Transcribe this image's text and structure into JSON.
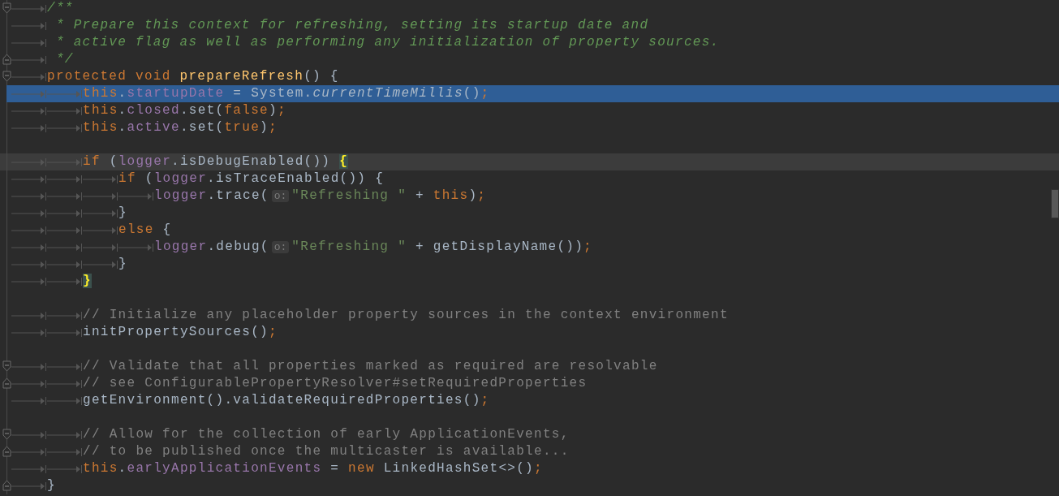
{
  "editor": {
    "lines": [
      {
        "selected": false,
        "caret": false,
        "fold_start": true,
        "fold_end": false,
        "indent": [
          {
            "kind": "tab"
          }
        ],
        "tokens": [
          {
            "kind": "doc",
            "text": "/**"
          }
        ]
      },
      {
        "selected": false,
        "caret": false,
        "fold_start": false,
        "fold_end": false,
        "indent": [
          {
            "kind": "tab"
          }
        ],
        "tokens": [
          {
            "kind": "doc",
            "text": " * Prepare this context for refreshing, setting its startup date and"
          }
        ]
      },
      {
        "selected": false,
        "caret": false,
        "fold_start": false,
        "fold_end": false,
        "indent": [
          {
            "kind": "tab"
          }
        ],
        "tokens": [
          {
            "kind": "doc",
            "text": " * active flag as well as performing any initialization of property sources."
          }
        ]
      },
      {
        "selected": false,
        "caret": false,
        "fold_start": false,
        "fold_end": true,
        "indent": [
          {
            "kind": "tab"
          }
        ],
        "tokens": [
          {
            "kind": "doc",
            "text": " */"
          }
        ]
      },
      {
        "selected": false,
        "caret": false,
        "fold_start": true,
        "fold_end": false,
        "indent": [
          {
            "kind": "tab"
          }
        ],
        "tokens": [
          {
            "kind": "keyword",
            "text": "protected void "
          },
          {
            "kind": "declaration",
            "text": "prepareRefresh"
          },
          {
            "kind": "plain",
            "text": "() {"
          }
        ]
      },
      {
        "selected": true,
        "caret": false,
        "fold_start": false,
        "fold_end": false,
        "indent": [
          {
            "kind": "tab"
          },
          {
            "kind": "tab"
          }
        ],
        "tokens": [
          {
            "kind": "keyword",
            "text": "this"
          },
          {
            "kind": "plain",
            "text": "."
          },
          {
            "kind": "field",
            "text": "startupDate"
          },
          {
            "kind": "plain",
            "text": " = System."
          },
          {
            "kind": "static",
            "text": "currentTimeMillis"
          },
          {
            "kind": "plain",
            "text": "()"
          },
          {
            "kind": "keyword",
            "text": ";"
          }
        ]
      },
      {
        "selected": false,
        "caret": false,
        "fold_start": false,
        "fold_end": false,
        "indent": [
          {
            "kind": "tab"
          },
          {
            "kind": "tab"
          }
        ],
        "tokens": [
          {
            "kind": "keyword",
            "text": "this"
          },
          {
            "kind": "plain",
            "text": "."
          },
          {
            "kind": "field",
            "text": "closed"
          },
          {
            "kind": "plain",
            "text": ".set("
          },
          {
            "kind": "keyword",
            "text": "false"
          },
          {
            "kind": "plain",
            "text": ")"
          },
          {
            "kind": "keyword",
            "text": ";"
          }
        ]
      },
      {
        "selected": false,
        "caret": false,
        "fold_start": false,
        "fold_end": false,
        "indent": [
          {
            "kind": "tab"
          },
          {
            "kind": "tab"
          }
        ],
        "tokens": [
          {
            "kind": "keyword",
            "text": "this"
          },
          {
            "kind": "plain",
            "text": "."
          },
          {
            "kind": "field",
            "text": "active"
          },
          {
            "kind": "plain",
            "text": ".set("
          },
          {
            "kind": "keyword",
            "text": "true"
          },
          {
            "kind": "plain",
            "text": ")"
          },
          {
            "kind": "keyword",
            "text": ";"
          }
        ]
      },
      {
        "selected": false,
        "caret": false,
        "fold_start": false,
        "fold_end": false
      },
      {
        "selected": false,
        "caret": true,
        "fold_start": false,
        "fold_end": false,
        "indent": [
          {
            "kind": "tab"
          },
          {
            "kind": "tab"
          }
        ],
        "tokens": [
          {
            "kind": "keyword",
            "text": "if "
          },
          {
            "kind": "plain",
            "text": "("
          },
          {
            "kind": "field",
            "text": "logger"
          },
          {
            "kind": "plain",
            "text": ".isDebugEnabled()) "
          },
          {
            "kind": "brace-match",
            "text": "{"
          }
        ]
      },
      {
        "selected": false,
        "caret": false,
        "fold_start": false,
        "fold_end": false,
        "indent": [
          {
            "kind": "tab"
          },
          {
            "kind": "tab"
          },
          {
            "kind": "tab"
          }
        ],
        "tokens": [
          {
            "kind": "keyword",
            "text": "if "
          },
          {
            "kind": "plain",
            "text": "("
          },
          {
            "kind": "field",
            "text": "logger"
          },
          {
            "kind": "plain",
            "text": ".isTraceEnabled()) {"
          }
        ]
      },
      {
        "selected": false,
        "caret": false,
        "fold_start": false,
        "fold_end": false,
        "indent": [
          {
            "kind": "tab"
          },
          {
            "kind": "tab"
          },
          {
            "kind": "tab"
          },
          {
            "kind": "tab"
          }
        ],
        "tokens": [
          {
            "kind": "field",
            "text": "logger"
          },
          {
            "kind": "plain",
            "text": ".trace("
          },
          {
            "kind": "hint",
            "text": "o:"
          },
          {
            "kind": "string",
            "text": "\"Refreshing \""
          },
          {
            "kind": "plain",
            "text": " + "
          },
          {
            "kind": "keyword",
            "text": "this"
          },
          {
            "kind": "plain",
            "text": ")"
          },
          {
            "kind": "keyword",
            "text": ";"
          }
        ]
      },
      {
        "selected": false,
        "caret": false,
        "fold_start": false,
        "fold_end": false,
        "indent": [
          {
            "kind": "tab"
          },
          {
            "kind": "tab"
          },
          {
            "kind": "tab"
          }
        ],
        "tokens": [
          {
            "kind": "plain",
            "text": "}"
          }
        ]
      },
      {
        "selected": false,
        "caret": false,
        "fold_start": false,
        "fold_end": false,
        "indent": [
          {
            "kind": "tab"
          },
          {
            "kind": "tab"
          },
          {
            "kind": "tab"
          }
        ],
        "tokens": [
          {
            "kind": "keyword",
            "text": "else "
          },
          {
            "kind": "plain",
            "text": "{"
          }
        ]
      },
      {
        "selected": false,
        "caret": false,
        "fold_start": false,
        "fold_end": false,
        "indent": [
          {
            "kind": "tab"
          },
          {
            "kind": "tab"
          },
          {
            "kind": "tab"
          },
          {
            "kind": "tab"
          }
        ],
        "tokens": [
          {
            "kind": "field",
            "text": "logger"
          },
          {
            "kind": "plain",
            "text": ".debug("
          },
          {
            "kind": "hint",
            "text": "o:"
          },
          {
            "kind": "string",
            "text": "\"Refreshing \""
          },
          {
            "kind": "plain",
            "text": " + getDisplayName())"
          },
          {
            "kind": "keyword",
            "text": ";"
          }
        ]
      },
      {
        "selected": false,
        "caret": false,
        "fold_start": false,
        "fold_end": false,
        "indent": [
          {
            "kind": "tab"
          },
          {
            "kind": "tab"
          },
          {
            "kind": "tab"
          }
        ],
        "tokens": [
          {
            "kind": "plain",
            "text": "}"
          }
        ]
      },
      {
        "selected": false,
        "caret": false,
        "fold_start": false,
        "fold_end": false,
        "indent": [
          {
            "kind": "tab"
          },
          {
            "kind": "tab"
          }
        ],
        "tokens": [
          {
            "kind": "brace-match",
            "text": "}"
          }
        ]
      },
      {
        "selected": false,
        "caret": false,
        "fold_start": false,
        "fold_end": false
      },
      {
        "selected": false,
        "caret": false,
        "fold_start": false,
        "fold_end": false,
        "indent": [
          {
            "kind": "tab"
          },
          {
            "kind": "tab"
          }
        ],
        "tokens": [
          {
            "kind": "comment",
            "text": "// Initialize any placeholder property sources in the context environment"
          }
        ]
      },
      {
        "selected": false,
        "caret": false,
        "fold_start": false,
        "fold_end": false,
        "indent": [
          {
            "kind": "tab"
          },
          {
            "kind": "tab"
          }
        ],
        "tokens": [
          {
            "kind": "plain",
            "text": "initPropertySources()"
          },
          {
            "kind": "keyword",
            "text": ";"
          }
        ]
      },
      {
        "selected": false,
        "caret": false,
        "fold_start": false,
        "fold_end": false
      },
      {
        "selected": false,
        "caret": false,
        "fold_start": true,
        "fold_end": false,
        "indent": [
          {
            "kind": "tab"
          },
          {
            "kind": "tab"
          }
        ],
        "tokens": [
          {
            "kind": "comment",
            "text": "// Validate that all properties marked as required are resolvable"
          }
        ]
      },
      {
        "selected": false,
        "caret": false,
        "fold_start": false,
        "fold_end": true,
        "indent": [
          {
            "kind": "tab"
          },
          {
            "kind": "tab"
          }
        ],
        "tokens": [
          {
            "kind": "comment",
            "text": "// see ConfigurablePropertyResolver#setRequiredProperties"
          }
        ]
      },
      {
        "selected": false,
        "caret": false,
        "fold_start": false,
        "fold_end": false,
        "indent": [
          {
            "kind": "tab"
          },
          {
            "kind": "tab"
          }
        ],
        "tokens": [
          {
            "kind": "plain",
            "text": "getEnvironment().validateRequiredProperties()"
          },
          {
            "kind": "keyword",
            "text": ";"
          }
        ]
      },
      {
        "selected": false,
        "caret": false,
        "fold_start": false,
        "fold_end": false
      },
      {
        "selected": false,
        "caret": false,
        "fold_start": true,
        "fold_end": false,
        "indent": [
          {
            "kind": "tab"
          },
          {
            "kind": "tab"
          }
        ],
        "tokens": [
          {
            "kind": "comment",
            "text": "// Allow for the collection of early ApplicationEvents,"
          }
        ]
      },
      {
        "selected": false,
        "caret": false,
        "fold_start": false,
        "fold_end": true,
        "indent": [
          {
            "kind": "tab"
          },
          {
            "kind": "tab"
          }
        ],
        "tokens": [
          {
            "kind": "comment",
            "text": "// to be published once the multicaster is available..."
          }
        ]
      },
      {
        "selected": false,
        "caret": false,
        "fold_start": false,
        "fold_end": false,
        "indent": [
          {
            "kind": "tab"
          },
          {
            "kind": "tab"
          }
        ],
        "tokens": [
          {
            "kind": "keyword",
            "text": "this"
          },
          {
            "kind": "plain",
            "text": "."
          },
          {
            "kind": "field",
            "text": "earlyApplicationEvents"
          },
          {
            "kind": "plain",
            "text": " = "
          },
          {
            "kind": "keyword",
            "text": "new "
          },
          {
            "kind": "plain",
            "text": "LinkedHashSet<>()"
          },
          {
            "kind": "keyword",
            "text": ";"
          }
        ]
      },
      {
        "selected": false,
        "caret": false,
        "fold_start": false,
        "fold_end": true,
        "indent": [
          {
            "kind": "tab"
          }
        ],
        "tokens": [
          {
            "kind": "plain",
            "text": "}"
          }
        ]
      }
    ]
  }
}
